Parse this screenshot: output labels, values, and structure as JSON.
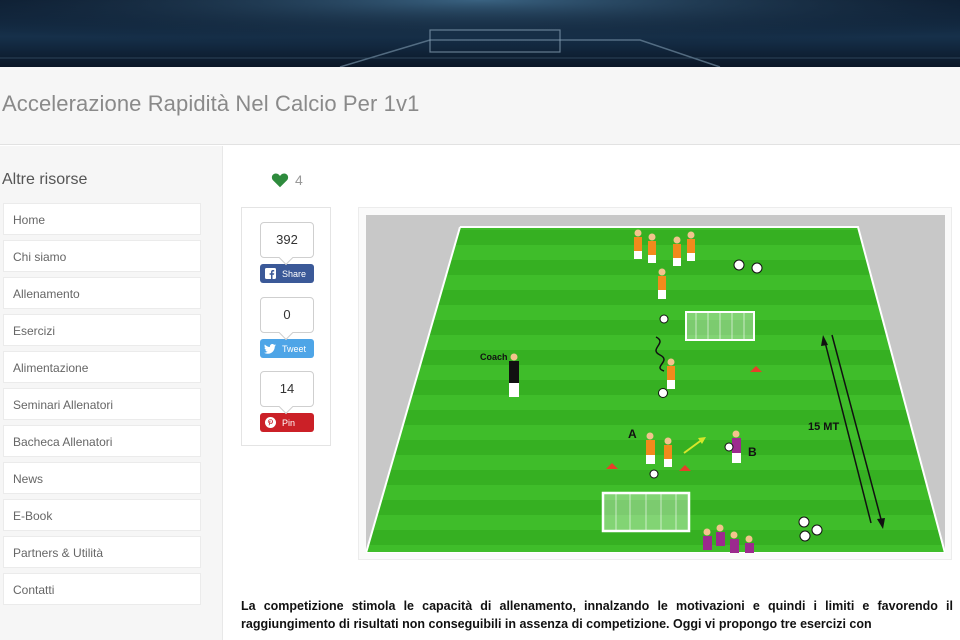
{
  "page": {
    "title": "Accelerazione Rapidità Nel Calcio Per 1v1"
  },
  "sidebar": {
    "heading": "Altre risorse",
    "items": [
      {
        "label": "Home"
      },
      {
        "label": "Chi siamo"
      },
      {
        "label": "Allenamento"
      },
      {
        "label": "Esercizi"
      },
      {
        "label": "Alimentazione"
      },
      {
        "label": "Seminari Allenatori"
      },
      {
        "label": "Bacheca Allenatori"
      },
      {
        "label": "News"
      },
      {
        "label": "E-Book"
      },
      {
        "label": "Partners & Utilità"
      },
      {
        "label": "Contatti"
      }
    ]
  },
  "likes": {
    "count": "4",
    "icon": "heart-icon",
    "color": "#2e8b3d"
  },
  "share": {
    "facebook": {
      "count": "392",
      "label": "Share",
      "icon": "facebook-icon",
      "color": "#3b5998"
    },
    "twitter": {
      "count": "0",
      "label": "Tweet",
      "icon": "twitter-icon",
      "color": "#4ea5e7"
    },
    "pinterest": {
      "count": "14",
      "label": "Pin",
      "icon": "pinterest-icon",
      "color": "#cb2027"
    }
  },
  "diagram": {
    "coach_label": "Coach",
    "label_a": "A",
    "label_b": "B",
    "distance_label": "15 MT"
  },
  "article": {
    "text": "La competizione stimola le capacità di allenamento, innalzando le motivazioni e quindi i limiti e favorendo il raggiungimento di  risultati non conseguibili in assenza di competizione. Oggi vi propongo tre esercizi con"
  }
}
